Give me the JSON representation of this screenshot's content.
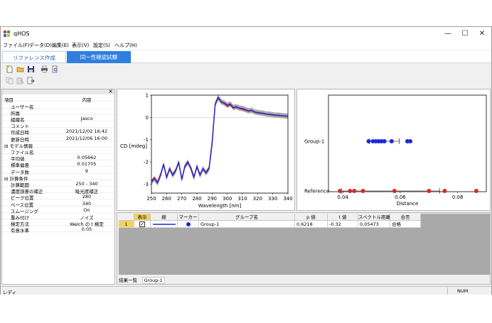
{
  "window": {
    "title": "qHOS",
    "minimize": "—",
    "maximize": "☐",
    "close": "✕"
  },
  "menu": [
    "ファイル(F)",
    "データ(D)",
    "編集(E)",
    "表示(V)",
    "設定(S)",
    "ヘルプ(H)"
  ],
  "tabs": {
    "reference": "リファレンス作成",
    "identity_test": "同一性確認試験"
  },
  "properties": {
    "header_key": "項目",
    "header_value": "内容",
    "rows": [
      {
        "key": "ユーザー名",
        "value": "",
        "type": "item"
      },
      {
        "key": "所属",
        "value": "",
        "type": "item"
      },
      {
        "key": "組織名",
        "value": "Jasco",
        "type": "item"
      },
      {
        "key": "コメント",
        "value": "",
        "type": "item"
      },
      {
        "key": "作成日時",
        "value": "2021/12/02 16:42",
        "type": "item"
      },
      {
        "key": "更新日時",
        "value": "2021/12/06 16:00",
        "type": "item"
      },
      {
        "key": "⊟ モデル情報",
        "value": "",
        "type": "cat"
      },
      {
        "key": "ファイル名",
        "value": "",
        "type": "item"
      },
      {
        "key": "平均値",
        "value": "0.05662",
        "type": "item"
      },
      {
        "key": "標準偏差",
        "value": "0.01705",
        "type": "item"
      },
      {
        "key": "データ数",
        "value": "9",
        "type": "item"
      },
      {
        "key": "⊟ 計算条件",
        "value": "",
        "type": "cat"
      },
      {
        "key": "計算範囲",
        "value": "250 - 340",
        "type": "item"
      },
      {
        "key": "濃度誤差の補正",
        "value": "吸光度補正",
        "type": "item"
      },
      {
        "key": "ピーク位置",
        "value": "280",
        "type": "item"
      },
      {
        "key": "ベース位置",
        "value": "340",
        "type": "item"
      },
      {
        "key": "スムージング",
        "value": "On",
        "type": "item"
      },
      {
        "key": "重み付け",
        "value": "ノイズ",
        "type": "item"
      },
      {
        "key": "検定方法",
        "value": "Welch の t 検定",
        "type": "item"
      },
      {
        "key": "有意水準",
        "value": "0.05",
        "type": "item"
      }
    ]
  },
  "results": {
    "headers": [
      "表示",
      "線",
      "マーカー",
      "グループ名",
      "p 値",
      "t 値",
      "スペクトル距離",
      "合否"
    ],
    "rows": [
      {
        "index": "1",
        "show": "✓",
        "group": "Group-1",
        "p": "0.6218",
        "t": "-0.32",
        "distance": "0.05473",
        "result": "合格"
      }
    ],
    "bottom_tabs": [
      "結果一覧",
      "Group-1"
    ]
  },
  "status": {
    "ready": "レディ",
    "num": "NUM"
  },
  "chart_data": [
    {
      "type": "line",
      "xlabel": "Wavelength [nm]",
      "ylabel": "CD [mdeg]",
      "xlim": [
        250,
        340
      ],
      "ylim": [
        -3.4,
        1.0
      ],
      "xticks": [
        "250",
        "260",
        "270",
        "280",
        "290",
        "300",
        "310",
        "320",
        "330",
        "340"
      ],
      "yticks": [
        "1",
        "0",
        "-1",
        "-2",
        "-3"
      ],
      "x": [
        250,
        252,
        254,
        256,
        258,
        260,
        262,
        264,
        266,
        268,
        270,
        272,
        274,
        276,
        278,
        280,
        282,
        284,
        286,
        288,
        290,
        292,
        294,
        296,
        298,
        300,
        302,
        304,
        306,
        308,
        310,
        312,
        314,
        316,
        318,
        320,
        322,
        324,
        326,
        328,
        330,
        332,
        334,
        336,
        338,
        340
      ],
      "series": [
        {
          "color": "#1a2ad8",
          "values": [
            -2.9,
            -2.75,
            -2.95,
            -2.6,
            -2.1,
            -2.7,
            -2.3,
            -2.6,
            -2.4,
            -2.0,
            -2.8,
            -2.2,
            -2.0,
            -2.3,
            -2.7,
            -2.2,
            -2.6,
            -2.3,
            -2.5,
            -2.3,
            -1.2,
            0.6,
            0.9,
            0.7,
            0.65,
            0.55,
            0.6,
            0.45,
            0.48,
            0.42,
            0.4,
            0.35,
            0.3,
            0.32,
            0.25,
            0.22,
            0.2,
            0.18,
            0.15,
            0.14,
            0.12,
            0.1,
            0.1,
            0.08,
            0.07,
            0.05
          ]
        },
        {
          "color": "#d42a2a",
          "values": [
            -2.85,
            -2.7,
            -2.9,
            -2.55,
            -2.15,
            -2.65,
            -2.35,
            -2.55,
            -2.35,
            -2.05,
            -2.75,
            -2.25,
            -2.05,
            -2.25,
            -2.65,
            -2.25,
            -2.55,
            -2.35,
            -2.45,
            -2.25,
            -1.1,
            0.55,
            0.85,
            0.68,
            0.62,
            0.5,
            0.55,
            0.42,
            0.45,
            0.4,
            0.36,
            0.32,
            0.28,
            0.3,
            0.23,
            0.2,
            0.18,
            0.16,
            0.14,
            0.12,
            0.1,
            0.09,
            0.08,
            0.07,
            0.06,
            0.05
          ]
        }
      ],
      "band_color": "#8f8f8f"
    },
    {
      "type": "scatter",
      "xlabel": "Distance",
      "xlim": [
        0.035,
        0.09
      ],
      "xticks": [
        "0.04",
        "0.06",
        "0.08"
      ],
      "categories": [
        "Group-1",
        "Reference"
      ],
      "series": [
        {
          "name": "Group-1",
          "color": "#1a2ad8",
          "values": [
            0.049,
            0.0505,
            0.0515,
            0.0525,
            0.0535,
            0.0545,
            0.057,
            0.0625,
            0.0635
          ],
          "error_bar": [
            0.0493,
            0.0597
          ]
        },
        {
          "name": "Reference",
          "color": "#d42a2a",
          "values": [
            0.039,
            0.0425,
            0.044,
            0.047,
            0.058,
            0.07,
            0.0755,
            0.0865
          ],
          "error_bar": [
            0.0395,
            0.0737
          ]
        }
      ]
    }
  ]
}
